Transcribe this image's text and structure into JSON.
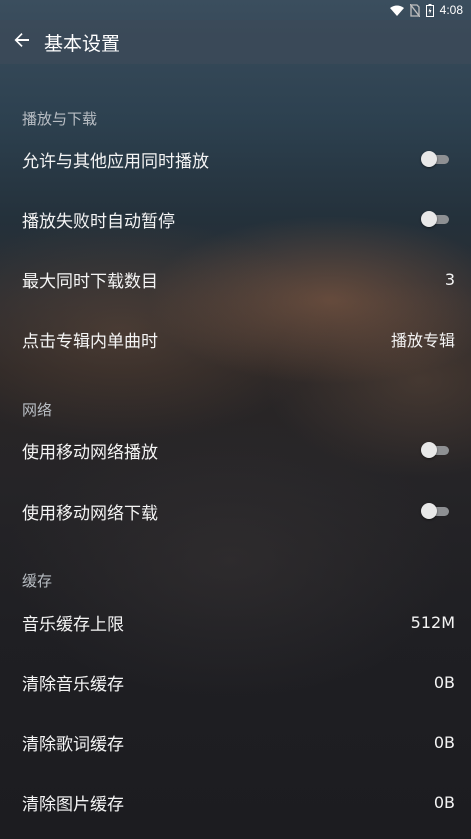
{
  "status_bar": {
    "time": "4:08",
    "icons": [
      "wifi-icon",
      "no-sim-icon",
      "battery-icon"
    ]
  },
  "app_bar": {
    "title": "基本设置",
    "back_icon": "arrow-back-icon"
  },
  "sections": {
    "playback": {
      "header": "播放与下载",
      "allow_simultaneous": {
        "label": "允许与其他应用同时播放",
        "enabled": false
      },
      "pause_on_fail": {
        "label": "播放失败时自动暂停",
        "enabled": false
      },
      "max_downloads": {
        "label": "最大同时下载数目",
        "value": "3"
      },
      "album_track_click": {
        "label": "点击专辑内单曲时",
        "value": "播放专辑"
      }
    },
    "network": {
      "header": "网络",
      "mobile_play": {
        "label": "使用移动网络播放",
        "enabled": false
      },
      "mobile_download": {
        "label": "使用移动网络下载",
        "enabled": false
      }
    },
    "cache": {
      "header": "缓存",
      "music_cache_limit": {
        "label": "音乐缓存上限",
        "value": "512M"
      },
      "clear_music": {
        "label": "清除音乐缓存",
        "value": "0B"
      },
      "clear_lyrics": {
        "label": "清除歌词缓存",
        "value": "0B"
      },
      "clear_images": {
        "label": "清除图片缓存",
        "value": "0B"
      }
    }
  }
}
